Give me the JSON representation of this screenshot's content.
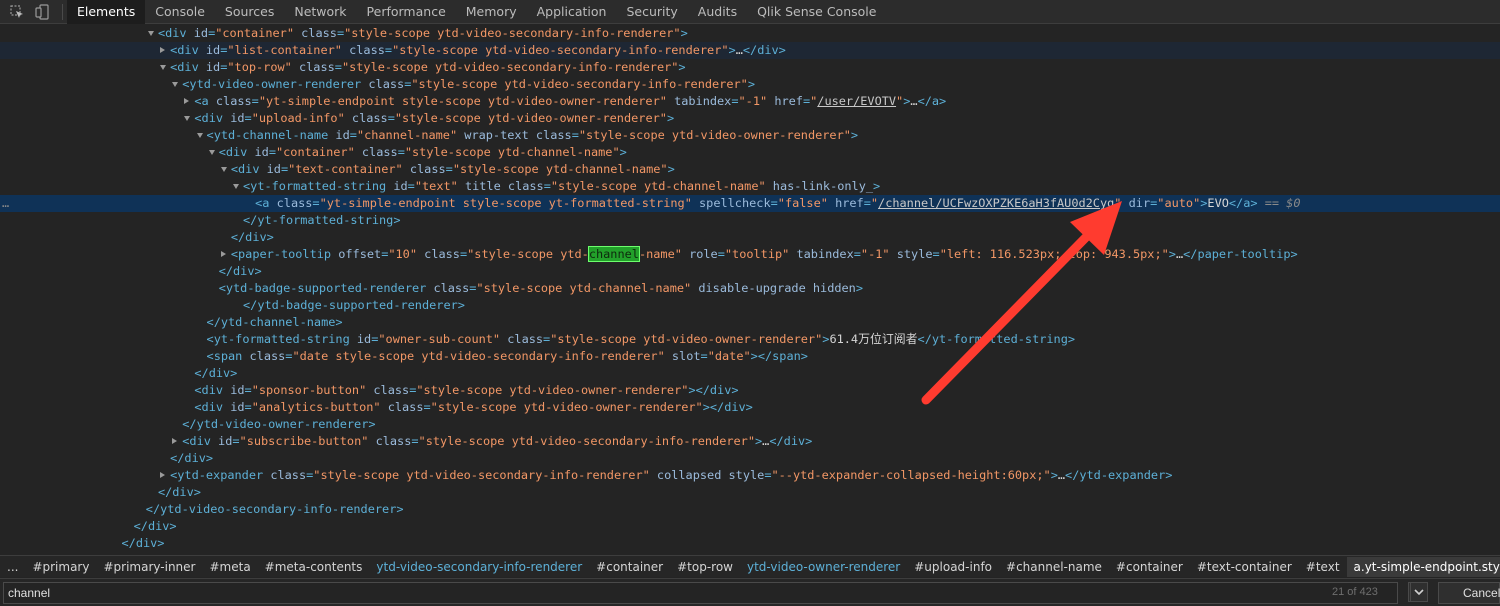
{
  "toolbar": {
    "icons": [
      "inspect-element-icon",
      "device-toolbar-icon"
    ],
    "tabs": [
      {
        "label": "Elements",
        "active": true
      },
      {
        "label": "Console"
      },
      {
        "label": "Sources"
      },
      {
        "label": "Network"
      },
      {
        "label": "Performance"
      },
      {
        "label": "Memory"
      },
      {
        "label": "Application"
      },
      {
        "label": "Security"
      },
      {
        "label": "Audits"
      },
      {
        "label": "Qlik Sense Console"
      }
    ]
  },
  "dom_tree": {
    "selected_suffix": " == $0",
    "lines": [
      {
        "indent": 13,
        "tri": "open",
        "tokens": [
          [
            "t",
            "<div "
          ],
          [
            "an",
            "id"
          ],
          [
            "t",
            "="
          ],
          [
            "av",
            "\"container\""
          ],
          [
            "an",
            " class"
          ],
          [
            "t",
            "="
          ],
          [
            "av",
            "\"style-scope ytd-video-secondary-info-renderer\""
          ],
          [
            "t",
            ">"
          ]
        ]
      },
      {
        "indent": 14,
        "tri": "closed",
        "hover": true,
        "tokens": [
          [
            "t",
            "<div "
          ],
          [
            "an",
            "id"
          ],
          [
            "t",
            "="
          ],
          [
            "av",
            "\"list-container\""
          ],
          [
            "an",
            " class"
          ],
          [
            "t",
            "="
          ],
          [
            "av",
            "\"style-scope ytd-video-secondary-info-renderer\""
          ],
          [
            "t",
            ">"
          ],
          [
            "tx",
            "…"
          ],
          [
            "t",
            "</div>"
          ]
        ]
      },
      {
        "indent": 14,
        "tri": "open",
        "tokens": [
          [
            "t",
            "<div "
          ],
          [
            "an",
            "id"
          ],
          [
            "t",
            "="
          ],
          [
            "av",
            "\"top-row\""
          ],
          [
            "an",
            " class"
          ],
          [
            "t",
            "="
          ],
          [
            "av",
            "\"style-scope ytd-video-secondary-info-renderer\""
          ],
          [
            "t",
            ">"
          ]
        ]
      },
      {
        "indent": 15,
        "tri": "open",
        "tokens": [
          [
            "t",
            "<ytd-video-owner-renderer "
          ],
          [
            "an",
            "class"
          ],
          [
            "t",
            "="
          ],
          [
            "av",
            "\"style-scope ytd-video-secondary-info-renderer\""
          ],
          [
            "t",
            ">"
          ]
        ]
      },
      {
        "indent": 16,
        "tri": "closed",
        "tokens": [
          [
            "t",
            "<a "
          ],
          [
            "an",
            "class"
          ],
          [
            "t",
            "="
          ],
          [
            "av",
            "\"yt-simple-endpoint style-scope ytd-video-owner-renderer\""
          ],
          [
            "an",
            " tabindex"
          ],
          [
            "t",
            "="
          ],
          [
            "av",
            "\"-1\""
          ],
          [
            "an",
            " href"
          ],
          [
            "t",
            "="
          ],
          [
            "av",
            "\""
          ],
          [
            "lk",
            "/user/EVOTV"
          ],
          [
            "av",
            "\""
          ],
          [
            "t",
            ">"
          ],
          [
            "tx",
            "…"
          ],
          [
            "t",
            "</a>"
          ]
        ]
      },
      {
        "indent": 16,
        "tri": "open",
        "tokens": [
          [
            "t",
            "<div "
          ],
          [
            "an",
            "id"
          ],
          [
            "t",
            "="
          ],
          [
            "av",
            "\"upload-info\""
          ],
          [
            "an",
            " class"
          ],
          [
            "t",
            "="
          ],
          [
            "av",
            "\"style-scope ytd-video-owner-renderer\""
          ],
          [
            "t",
            ">"
          ]
        ]
      },
      {
        "indent": 17,
        "tri": "open",
        "tokens": [
          [
            "t",
            "<ytd-channel-name "
          ],
          [
            "an",
            "id"
          ],
          [
            "t",
            "="
          ],
          [
            "av",
            "\"channel-name\""
          ],
          [
            "an",
            " wrap-text class"
          ],
          [
            "t",
            "="
          ],
          [
            "av",
            "\"style-scope ytd-video-owner-renderer\""
          ],
          [
            "t",
            ">"
          ]
        ]
      },
      {
        "indent": 18,
        "tri": "open",
        "tokens": [
          [
            "t",
            "<div "
          ],
          [
            "an",
            "id"
          ],
          [
            "t",
            "="
          ],
          [
            "av",
            "\"container\""
          ],
          [
            "an",
            " class"
          ],
          [
            "t",
            "="
          ],
          [
            "av",
            "\"style-scope ytd-channel-name\""
          ],
          [
            "t",
            ">"
          ]
        ]
      },
      {
        "indent": 19,
        "tri": "open",
        "tokens": [
          [
            "t",
            "<div "
          ],
          [
            "an",
            "id"
          ],
          [
            "t",
            "="
          ],
          [
            "av",
            "\"text-container\""
          ],
          [
            "an",
            " class"
          ],
          [
            "t",
            "="
          ],
          [
            "av",
            "\"style-scope ytd-channel-name\""
          ],
          [
            "t",
            ">"
          ]
        ]
      },
      {
        "indent": 20,
        "tri": "open",
        "tokens": [
          [
            "t",
            "<yt-formatted-string "
          ],
          [
            "an",
            "id"
          ],
          [
            "t",
            "="
          ],
          [
            "av",
            "\"text\""
          ],
          [
            "an",
            " title class"
          ],
          [
            "t",
            "="
          ],
          [
            "av",
            "\"style-scope ytd-channel-name\""
          ],
          [
            "an",
            " has-link-only_"
          ],
          [
            "t",
            ">"
          ]
        ]
      },
      {
        "indent": 21,
        "selected": true,
        "tokens": [
          [
            "t",
            "<a "
          ],
          [
            "an",
            "class"
          ],
          [
            "t",
            "="
          ],
          [
            "av",
            "\"yt-simple-endpoint style-scope yt-formatted-string\""
          ],
          [
            "an",
            " spellcheck"
          ],
          [
            "t",
            "="
          ],
          [
            "av",
            "\"false\""
          ],
          [
            "an",
            " href"
          ],
          [
            "t",
            "="
          ],
          [
            "av",
            "\""
          ],
          [
            "lk",
            "/channel/UCFwzOXPZKE6aH3fAU0d2Cyg"
          ],
          [
            "av",
            "\""
          ],
          [
            "an",
            " dir"
          ],
          [
            "t",
            "="
          ],
          [
            "av",
            "\"auto\""
          ],
          [
            "t",
            ">"
          ],
          [
            "tx",
            "EVO"
          ],
          [
            "t",
            "</a>"
          ]
        ]
      },
      {
        "indent": 20,
        "tokens": [
          [
            "t",
            "</yt-formatted-string>"
          ]
        ]
      },
      {
        "indent": 19,
        "tokens": [
          [
            "t",
            "</div>"
          ]
        ]
      },
      {
        "indent": 19,
        "tri": "closed",
        "tokens": [
          [
            "t",
            "<paper-tooltip "
          ],
          [
            "an",
            "offset"
          ],
          [
            "t",
            "="
          ],
          [
            "av",
            "\"10\""
          ],
          [
            "an",
            " class"
          ],
          [
            "t",
            "="
          ],
          [
            "av",
            "\"style-scope ytd-"
          ],
          [
            "hl",
            "channel"
          ],
          [
            "av",
            "-name\""
          ],
          [
            "an",
            " role"
          ],
          [
            "t",
            "="
          ],
          [
            "av",
            "\"tooltip\""
          ],
          [
            "an",
            " tabindex"
          ],
          [
            "t",
            "="
          ],
          [
            "av",
            "\"-1\""
          ],
          [
            "an",
            " style"
          ],
          [
            "t",
            "="
          ],
          [
            "av",
            "\"left: 116.523px; top: 943.5px;\""
          ],
          [
            "t",
            ">"
          ],
          [
            "tx",
            "…"
          ],
          [
            "t",
            "</paper-tooltip>"
          ]
        ]
      },
      {
        "indent": 18,
        "tokens": [
          [
            "t",
            "</div>"
          ]
        ]
      },
      {
        "indent": 18,
        "tokens": [
          [
            "t",
            "<ytd-badge-supported-renderer "
          ],
          [
            "an",
            "class"
          ],
          [
            "t",
            "="
          ],
          [
            "av",
            "\"style-scope ytd-channel-name\""
          ],
          [
            "an",
            " disable-upgrade hidden"
          ],
          [
            "t",
            ">"
          ]
        ]
      },
      {
        "indent": 20,
        "tokens": [
          [
            "t",
            "</ytd-badge-supported-renderer>"
          ]
        ]
      },
      {
        "indent": 17,
        "tokens": [
          [
            "t",
            "</ytd-channel-name>"
          ]
        ]
      },
      {
        "indent": 17,
        "tokens": [
          [
            "t",
            "<yt-formatted-string "
          ],
          [
            "an",
            "id"
          ],
          [
            "t",
            "="
          ],
          [
            "av",
            "\"owner-sub-count\""
          ],
          [
            "an",
            " class"
          ],
          [
            "t",
            "="
          ],
          [
            "av",
            "\"style-scope ytd-video-owner-renderer\""
          ],
          [
            "t",
            ">"
          ],
          [
            "tx",
            "61.4万位订阅者"
          ],
          [
            "t",
            "</yt-formatted-string>"
          ]
        ]
      },
      {
        "indent": 17,
        "tokens": [
          [
            "t",
            "<span "
          ],
          [
            "an",
            "class"
          ],
          [
            "t",
            "="
          ],
          [
            "av",
            "\"date style-scope ytd-video-secondary-info-renderer\""
          ],
          [
            "an",
            " slot"
          ],
          [
            "t",
            "="
          ],
          [
            "av",
            "\"date\""
          ],
          [
            "t",
            "></span>"
          ]
        ]
      },
      {
        "indent": 16,
        "tokens": [
          [
            "t",
            "</div>"
          ]
        ]
      },
      {
        "indent": 16,
        "tokens": [
          [
            "t",
            "<div "
          ],
          [
            "an",
            "id"
          ],
          [
            "t",
            "="
          ],
          [
            "av",
            "\"sponsor-button\""
          ],
          [
            "an",
            " class"
          ],
          [
            "t",
            "="
          ],
          [
            "av",
            "\"style-scope ytd-video-owner-renderer\""
          ],
          [
            "t",
            "></div>"
          ]
        ]
      },
      {
        "indent": 16,
        "tokens": [
          [
            "t",
            "<div "
          ],
          [
            "an",
            "id"
          ],
          [
            "t",
            "="
          ],
          [
            "av",
            "\"analytics-button\""
          ],
          [
            "an",
            " class"
          ],
          [
            "t",
            "="
          ],
          [
            "av",
            "\"style-scope ytd-video-owner-renderer\""
          ],
          [
            "t",
            "></div>"
          ]
        ]
      },
      {
        "indent": 15,
        "tokens": [
          [
            "t",
            "</ytd-video-owner-renderer>"
          ]
        ]
      },
      {
        "indent": 15,
        "tri": "closed",
        "tokens": [
          [
            "t",
            "<div "
          ],
          [
            "an",
            "id"
          ],
          [
            "t",
            "="
          ],
          [
            "av",
            "\"subscribe-button\""
          ],
          [
            "an",
            " class"
          ],
          [
            "t",
            "="
          ],
          [
            "av",
            "\"style-scope ytd-video-secondary-info-renderer\""
          ],
          [
            "t",
            ">"
          ],
          [
            "tx",
            "…"
          ],
          [
            "t",
            "</div>"
          ]
        ]
      },
      {
        "indent": 14,
        "tokens": [
          [
            "t",
            "</div>"
          ]
        ]
      },
      {
        "indent": 14,
        "tri": "closed",
        "tokens": [
          [
            "t",
            "<ytd-expander "
          ],
          [
            "an",
            "class"
          ],
          [
            "t",
            "="
          ],
          [
            "av",
            "\"style-scope ytd-video-secondary-info-renderer\""
          ],
          [
            "an",
            " collapsed style"
          ],
          [
            "t",
            "="
          ],
          [
            "av",
            "\"--ytd-expander-collapsed-height:60px;\""
          ],
          [
            "t",
            ">"
          ],
          [
            "tx",
            "…"
          ],
          [
            "t",
            "</ytd-expander>"
          ]
        ]
      },
      {
        "indent": 13,
        "tokens": [
          [
            "t",
            "</div>"
          ]
        ]
      },
      {
        "indent": 12,
        "tokens": [
          [
            "t",
            "</ytd-video-secondary-info-renderer>"
          ]
        ]
      },
      {
        "indent": 11,
        "tokens": [
          [
            "t",
            "</div>"
          ]
        ]
      },
      {
        "indent": 10,
        "tokens": [
          [
            "t",
            "</div>"
          ]
        ]
      }
    ]
  },
  "breadcrumbs": {
    "overflow": "...",
    "items": [
      {
        "label": "#primary"
      },
      {
        "label": "#primary-inner"
      },
      {
        "label": "#meta"
      },
      {
        "label": "#meta-contents"
      },
      {
        "label": "ytd-video-secondary-info-renderer",
        "tag": true
      },
      {
        "label": "#container"
      },
      {
        "label": "#top-row"
      },
      {
        "label": "ytd-video-owner-renderer",
        "tag": true
      },
      {
        "label": "#upload-info"
      },
      {
        "label": "#channel-name"
      },
      {
        "label": "#container"
      },
      {
        "label": "#text-container"
      },
      {
        "label": "#text"
      },
      {
        "label": "a.yt-simple-endpoint.style-scope.yt-formatted-string",
        "active": true
      }
    ]
  },
  "search": {
    "value": "channel",
    "match_count": "21 of 423",
    "cancel_label": "Cancel"
  },
  "annotation": {
    "color": "#ff3b2f"
  }
}
